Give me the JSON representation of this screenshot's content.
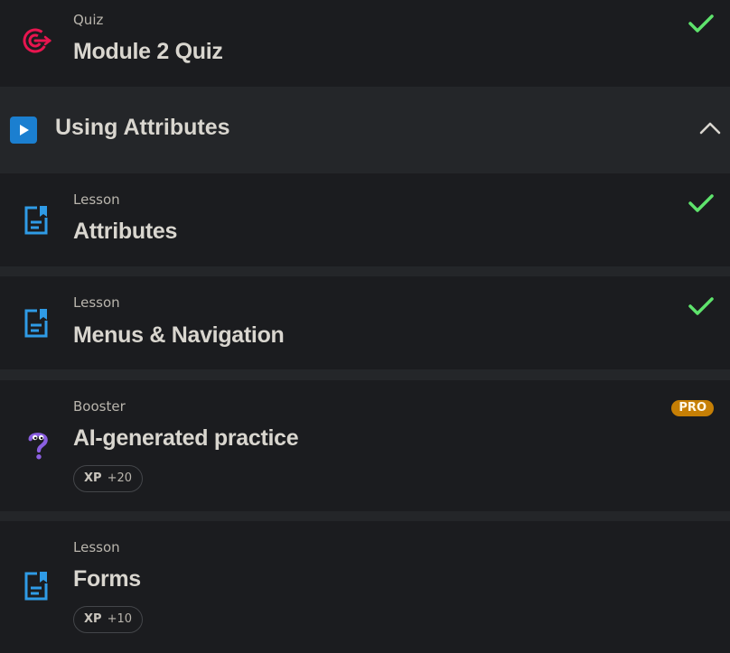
{
  "items_before": [
    {
      "type": "Quiz",
      "title": "Module 2 Quiz",
      "icon": "target-icon",
      "completed": true
    }
  ],
  "section": {
    "title": "Using Attributes",
    "icon": "play-icon",
    "expanded": true,
    "toggle_icon": "chevron-up-icon"
  },
  "items": [
    {
      "type": "Lesson",
      "title": "Attributes",
      "icon": "lesson-doc-icon",
      "completed": true
    },
    {
      "type": "Lesson",
      "title": "Menus & Navigation",
      "icon": "lesson-doc-icon",
      "completed": true
    },
    {
      "type": "Booster",
      "title": "AI-generated practice",
      "icon": "question-mascot-icon",
      "badge": "PRO",
      "xp_label": "XP",
      "xp_value": "+20"
    },
    {
      "type": "Lesson",
      "title": "Forms",
      "icon": "lesson-doc-icon",
      "xp_label": "XP",
      "xp_value": "+10"
    }
  ],
  "colors": {
    "check": "#5ee36c",
    "quiz_icon": "#e8154f",
    "lesson_icon": "#2f9be6",
    "booster_icon": "#8b5fe0",
    "pro_badge": "#c67f05",
    "section_play": "#1b7fd0"
  }
}
